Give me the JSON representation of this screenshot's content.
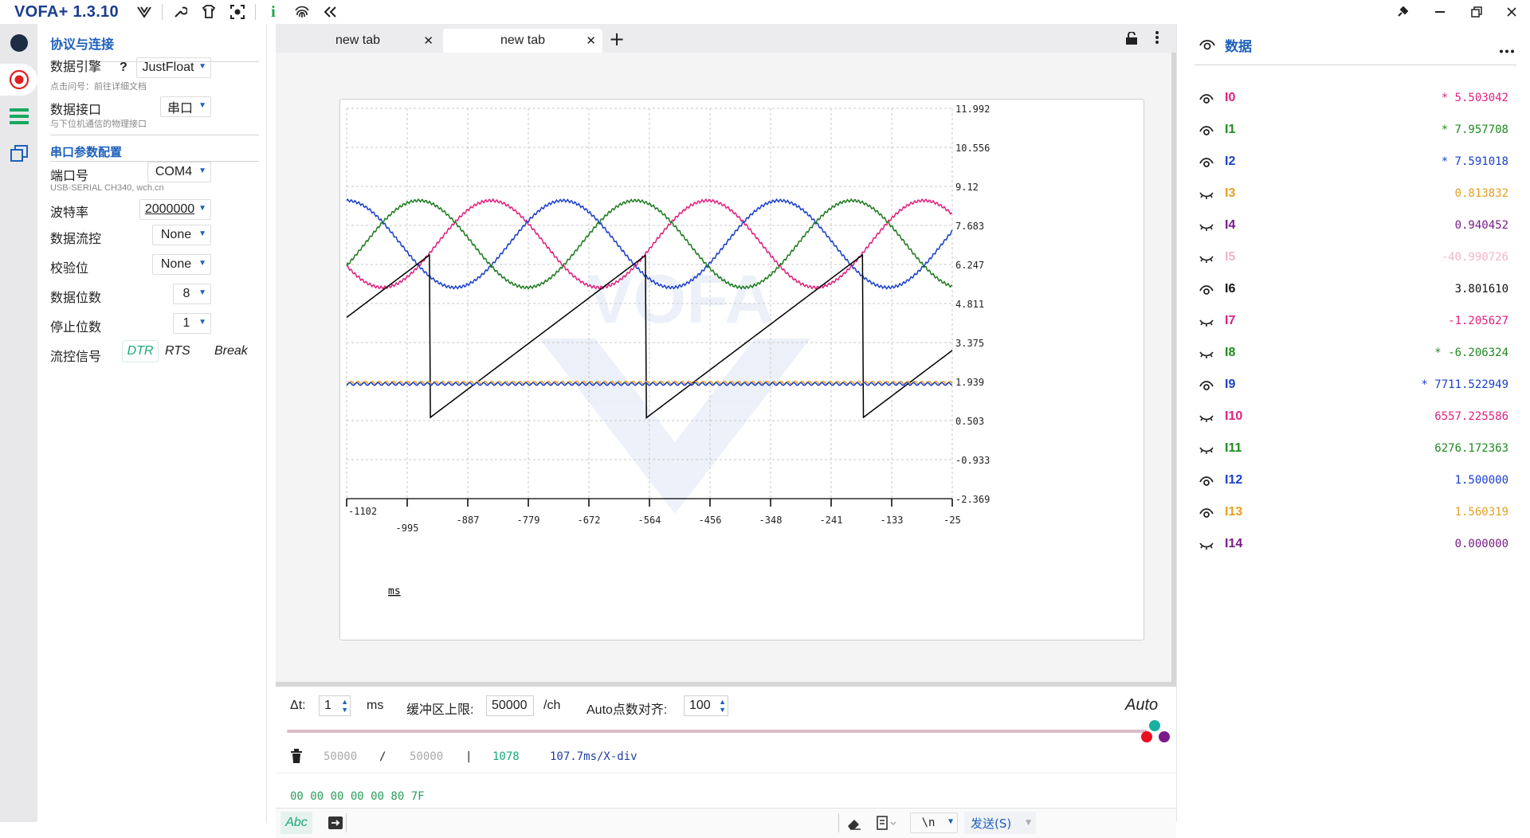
{
  "app": {
    "title": "VOFA+ 1.3.10"
  },
  "left": {
    "section1": "协议与连接",
    "engine_label": "数据引擎",
    "engine_help": "?",
    "engine_value": "JustFloat",
    "engine_hint": "点击问号：前往详细文档",
    "interface_label": "数据接口",
    "interface_value": "串口",
    "interface_hint": "与下位机通信的物理接口",
    "section2": "串口参数配置",
    "port_label": "端口号",
    "port_value": "COM4",
    "port_hint": "USB-SERIAL CH340, wch.cn",
    "baud_label": "波特率",
    "baud_value": "2000000",
    "flow_label": "数据流控",
    "flow_value": "None",
    "parity_label": "校验位",
    "parity_value": "None",
    "databits_label": "数据位数",
    "databits_value": "8",
    "stopbits_label": "停止位数",
    "stopbits_value": "1",
    "flowsig_label": "流控信号",
    "dtr": "DTR",
    "rts": "RTS",
    "brk": "Break"
  },
  "tabs": [
    {
      "label": "new tab"
    },
    {
      "label": "new tab"
    }
  ],
  "chart_data": {
    "type": "line",
    "x_tick_labels": [
      "-1102",
      "-995",
      "-887",
      "-779",
      "-672",
      "-564",
      "-456",
      "-348",
      "-241",
      "-133",
      "-25"
    ],
    "x_unit": "ms",
    "y_tick_labels": [
      "11.992",
      "10.556",
      "9.12",
      "7.683",
      "6.247",
      "4.811",
      "3.375",
      "1.939",
      "0.503",
      "-0.933",
      "-2.369"
    ],
    "xlim": [
      -1102,
      -25
    ],
    "ylim": [
      -2.369,
      11.992
    ],
    "grid": true,
    "series": [
      {
        "color": "#e0207f",
        "kind": "sine",
        "offset": 7.0,
        "amplitude": 1.6,
        "period_ms": 385,
        "phase_deg": -150
      },
      {
        "color": "#1a3fc9",
        "kind": "sine",
        "offset": 7.0,
        "amplitude": 1.6,
        "period_ms": 385,
        "phase_deg": 90
      },
      {
        "color": "#1e7a1e",
        "kind": "sine",
        "offset": 7.0,
        "amplitude": 1.6,
        "period_ms": 385,
        "phase_deg": -30
      },
      {
        "color": "#000000",
        "kind": "sawtooth",
        "period_ms": 385,
        "low": 0.6,
        "high": 6.6,
        "start_ms": -1102,
        "start_value": 4.3
      },
      {
        "color": "#e6a020",
        "kind": "flat",
        "value": 1.9
      },
      {
        "color": "#1a3fc9",
        "kind": "flat",
        "value": 1.85
      }
    ]
  },
  "controls": {
    "dt_label": "Δt:",
    "dt_value": "1",
    "dt_unit": "ms",
    "buf_label": "缓冲区上限:",
    "buf_value": "50000",
    "buf_unit": "/ch",
    "auto_label": "Auto点数对齐:",
    "auto_value": "100",
    "auto_mode": "Auto"
  },
  "status": {
    "a": "50000",
    "slash": "/",
    "b": "50000",
    "bar": "|",
    "count": "1078",
    "rate": "107.7ms/X-div"
  },
  "hex": "00 00 00 00 00 80 7F",
  "send": {
    "abc": "Abc",
    "eol": "\\n",
    "send_label": "发送(S)"
  },
  "right": {
    "title": "数据",
    "channels": [
      {
        "name": "I0",
        "value": "* 5.503042",
        "color": "#e0207f"
      },
      {
        "name": "I1",
        "value": "* 7.957708",
        "color": "#1e8a1e"
      },
      {
        "name": "I2",
        "value": "* 7.591018",
        "color": "#1a3fc9"
      },
      {
        "name": "I3",
        "value": "0.813832",
        "color": "#e6a020"
      },
      {
        "name": "I4",
        "value": "0.940452",
        "color": "#7a1a8a"
      },
      {
        "name": "I5",
        "value": "-40.990726",
        "color": "#f3b3cc"
      },
      {
        "name": "I6",
        "value": "3.801610",
        "color": "#111111"
      },
      {
        "name": "I7",
        "value": "-1.205627",
        "color": "#e0207f"
      },
      {
        "name": "I8",
        "value": "* -6.206324",
        "color": "#1e8a1e"
      },
      {
        "name": "I9",
        "value": "* 7711.522949",
        "color": "#1a3fc9"
      },
      {
        "name": "I10",
        "value": "6557.225586",
        "color": "#e0207f"
      },
      {
        "name": "I11",
        "value": "6276.172363",
        "color": "#1e8a1e"
      },
      {
        "name": "I12",
        "value": "1.500000",
        "color": "#1a3fc9"
      },
      {
        "name": "I13",
        "value": "1.560319",
        "color": "#e6a020"
      },
      {
        "name": "I14",
        "value": "0.000000",
        "color": "#7a1a8a"
      }
    ],
    "visible": [
      true,
      true,
      true,
      false,
      false,
      false,
      true,
      false,
      false,
      true,
      false,
      false,
      true,
      true,
      false
    ]
  }
}
